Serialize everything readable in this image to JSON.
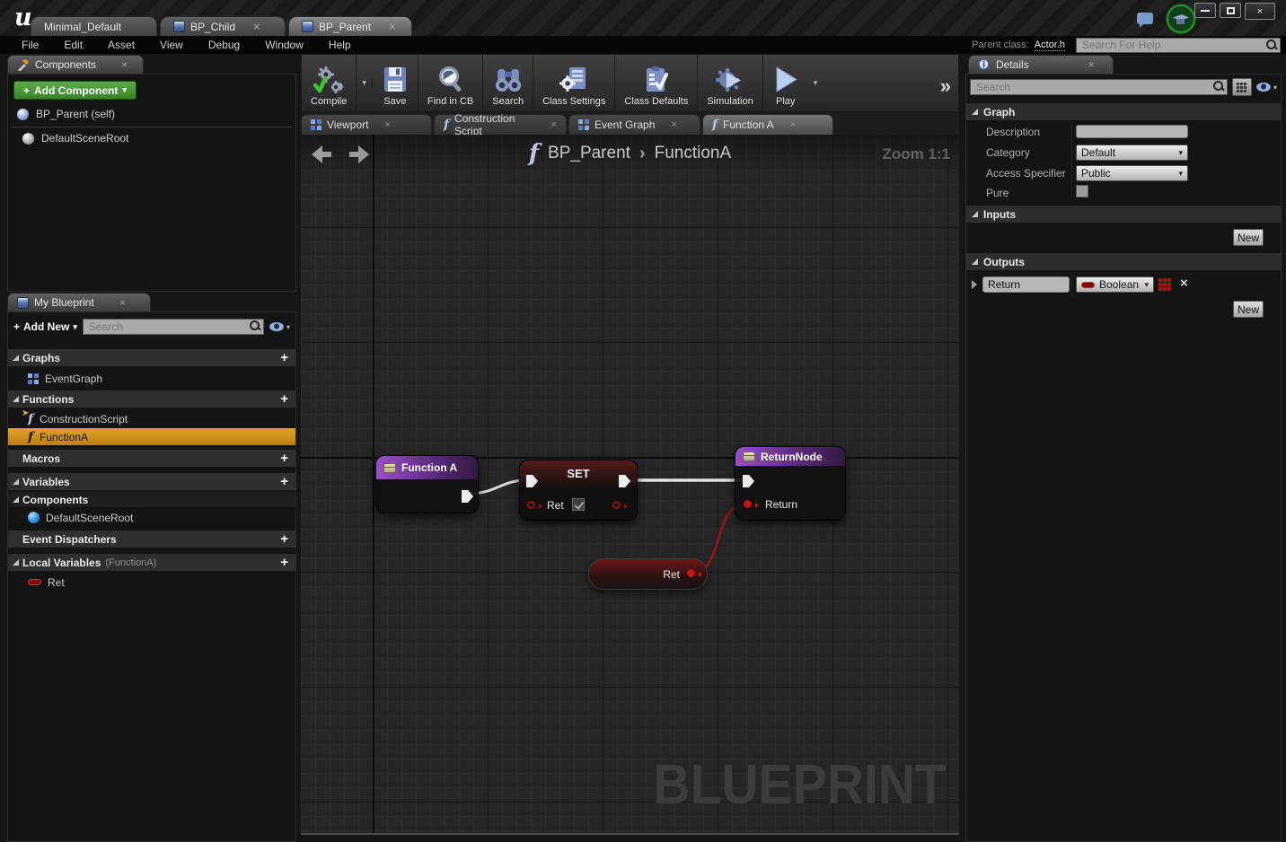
{
  "glyphs": {
    "plus": "+",
    "close": "×",
    "chevron_down": "▾",
    "breadcrumb_sep": "›",
    "double_chevron": "»",
    "f": "f"
  },
  "titlebar": {
    "logo": "u",
    "tabs": [
      {
        "label": "Minimal_Default"
      },
      {
        "label": "BP_Child"
      },
      {
        "label": "BP_Parent"
      }
    ]
  },
  "menubar": {
    "items": [
      "File",
      "Edit",
      "Asset",
      "View",
      "Debug",
      "Window",
      "Help"
    ],
    "parent_class_label": "Parent class:",
    "parent_class_value": "Actor.h",
    "help_placeholder": "Search For Help"
  },
  "toolbar": {
    "buttons": [
      "Compile",
      "Save",
      "Find in CB",
      "Search",
      "Class Settings",
      "Class Defaults",
      "Simulation",
      "Play"
    ]
  },
  "components": {
    "tab": "Components",
    "add_component": "Add Component",
    "self_item": "BP_Parent (self)",
    "scene_root": "DefaultSceneRoot"
  },
  "my_blueprint": {
    "tab": "My Blueprint",
    "add_new": "Add New",
    "search_placeholder": "Search",
    "graphs_header": "Graphs",
    "event_graph": "EventGraph",
    "functions_header": "Functions",
    "construction_script": "ConstructionScript",
    "function_a": "FunctionA",
    "macros_header": "Macros",
    "variables_header": "Variables",
    "components_header": "Components",
    "scene_root": "DefaultSceneRoot",
    "event_dispatchers_header": "Event Dispatchers",
    "local_variables_header": "Local Variables",
    "local_variables_context": "(FunctionA)",
    "ret_var": "Ret"
  },
  "graph": {
    "tabs": [
      "Viewport",
      "Construction Script",
      "Event Graph",
      "Function A"
    ],
    "breadcrumb_root": "BP_Parent",
    "breadcrumb_leaf": "FunctionA",
    "zoom_label": "Zoom 1:1",
    "watermark": "BLUEPRINT",
    "nodes": {
      "function_a": {
        "title": "Function A"
      },
      "set_node": {
        "title": "SET",
        "pin_label": "Ret"
      },
      "return_node": {
        "title": "ReturnNode",
        "pin_label": "Return"
      },
      "ret_var": {
        "label": "Ret"
      }
    }
  },
  "details": {
    "tab": "Details",
    "search_placeholder": "Search",
    "graph_section": "Graph",
    "description_label": "Description",
    "category_label": "Category",
    "category_value": "Default",
    "access_label": "Access Specifier",
    "access_value": "Public",
    "pure_label": "Pure",
    "inputs_header": "Inputs",
    "outputs_header": "Outputs",
    "new_button": "New",
    "output_name": "Return",
    "output_type": "Boolean"
  },
  "colors": {
    "selection_orange": "#d89a28",
    "add_green": "#3a8328",
    "node_purple": "#7b3fa0",
    "bool_red": "#7c0a08",
    "wire_red": "#9b1313"
  }
}
